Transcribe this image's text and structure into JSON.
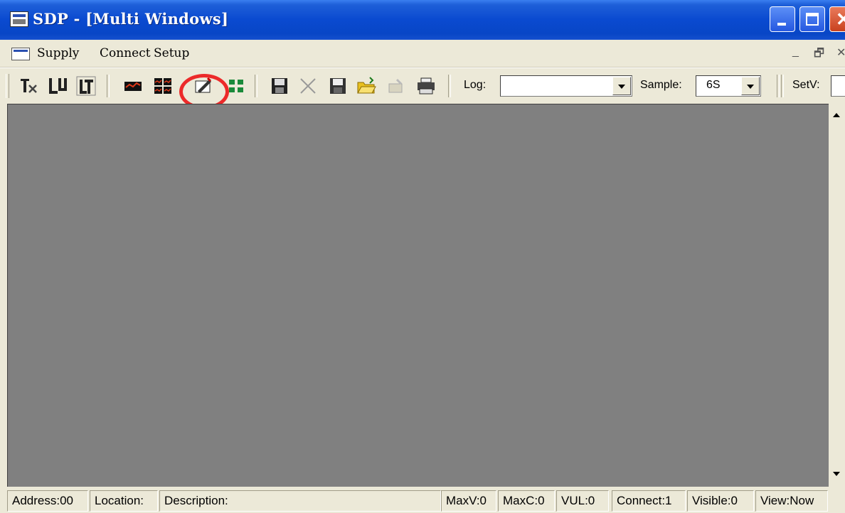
{
  "window": {
    "title": "SDP - [Multi Windows]"
  },
  "menu": {
    "supply": "Supply",
    "connect": "Connect",
    "setup": "Setup"
  },
  "toolbar": {
    "buttons": [
      "tx-icon",
      "lu-icon",
      "lt-icon",
      "chart-icon",
      "grid-icon",
      "edit-tool-icon",
      "tiles-icon",
      "save-icon",
      "delete-icon",
      "save-as-icon",
      "open-folder-icon",
      "export-icon",
      "print-icon"
    ],
    "log_label": "Log:",
    "log_value": "",
    "sample_label": "Sample:",
    "sample_value": "6S",
    "setv_label": "SetV:",
    "highlight_color": "#ec2a2a"
  },
  "status": {
    "address": "Address:00",
    "location": "Location:",
    "description": "Description:",
    "maxv": "MaxV:0",
    "maxc": "MaxC:0",
    "vul": "VUL:0",
    "connect": "Connect:1",
    "visible": "Visible:0",
    "view": "View:Now"
  }
}
